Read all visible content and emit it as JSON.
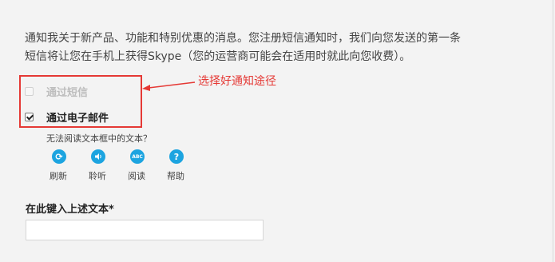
{
  "notice": {
    "line1": "通知我关于新产品、功能和特别优惠的消息。您注册短信通知时，我们向您发送的第一条",
    "line2": "短信将让您在手机上获得Skype（您的运营商可能会在适用时就此向您收费）。"
  },
  "options": {
    "sms": {
      "label": "通过短信",
      "checked": false,
      "disabled": true
    },
    "email": {
      "label": "通过电子邮件",
      "checked": true,
      "disabled": false
    }
  },
  "annotation": {
    "text": "选择好通知途径",
    "color": "#e53935"
  },
  "captcha": {
    "question": "无法阅读文本框中的文本？",
    "tools": [
      {
        "label": "刷新",
        "icon": "refresh-icon"
      },
      {
        "label": "聆听",
        "icon": "speaker-icon"
      },
      {
        "label": "阅读",
        "icon": "abc-icon",
        "icon_text": "ABC"
      },
      {
        "label": "帮助",
        "icon": "help-icon"
      }
    ],
    "input_label": "在此键入上述文本*",
    "input_value": ""
  },
  "colors": {
    "accent": "#1ca4e0",
    "annotation": "#e53935",
    "background": "#f3f3f3"
  }
}
